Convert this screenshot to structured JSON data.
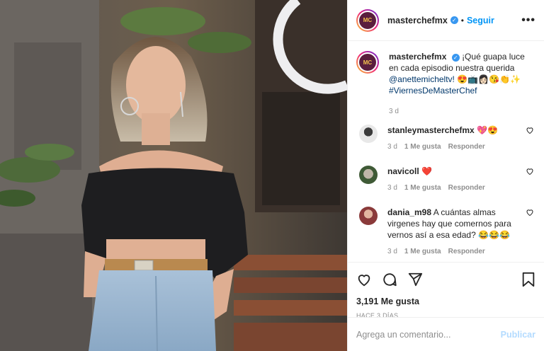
{
  "header": {
    "username": "masterchefmx",
    "verified_mark": "✓",
    "separator": "•",
    "follow_label": "Seguir",
    "more_label": "•••",
    "avatar_text": "MC"
  },
  "caption": {
    "username": "masterchefmx",
    "text_1": "¡Qué guapa luce en cada episodio nuestra querida",
    "mention": "@anettemicheltv!",
    "emojis": "😍📺👩🏻😘👏✨",
    "hashtag": "#ViernesDeMasterChef",
    "time": "3 d"
  },
  "comments": [
    {
      "username": "stanleymasterchefmx",
      "text": "💖😍",
      "time": "3 d",
      "likes": "1 Me gusta",
      "reply": "Responder"
    },
    {
      "username": "navicoll",
      "text": "❤️",
      "time": "3 d",
      "likes": "1 Me gusta",
      "reply": "Responder"
    },
    {
      "username": "dania_m98",
      "text": "A cuántas almas virgenes hay que comernos para vernos así a esa edad? 😂😂😂",
      "time": "3 d",
      "likes": "1 Me gusta",
      "reply": "Responder"
    }
  ],
  "stats": {
    "likes": "3,191 Me gusta",
    "posted": "HACE 3 DÍAS"
  },
  "compose": {
    "placeholder": "Agrega un comentario...",
    "post_label": "Publicar"
  },
  "icons": [
    "heart-icon",
    "comment-icon",
    "share-icon",
    "bookmark-icon",
    "verified-icon",
    "more-icon"
  ],
  "colors": {
    "link": "#00376b",
    "follow": "#0095f6",
    "muted": "#8e8e8e",
    "post_disabled": "#b3dbff"
  }
}
